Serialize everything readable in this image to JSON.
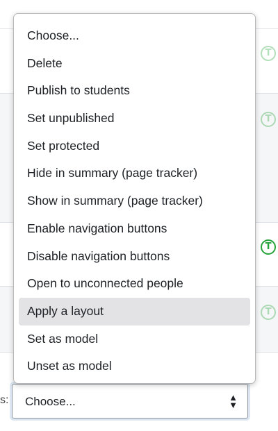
{
  "background": {
    "bulk_action_label": "s:",
    "bulk_select_value": "Choose...",
    "caret_up": "▲",
    "caret_down": "▼",
    "t_icon_glyph": "T",
    "t_icon_color": "#26a33b"
  },
  "dropdown": {
    "highlighted_index": 10,
    "options": [
      "Choose...",
      "Delete",
      "Publish to students",
      "Set unpublished",
      "Set protected",
      "Hide in summary (page tracker)",
      "Show in summary (page tracker)",
      "Enable navigation buttons",
      "Disable navigation buttons",
      "Open to unconnected people",
      "Apply a layout",
      "Set as model",
      "Unset as model"
    ]
  }
}
